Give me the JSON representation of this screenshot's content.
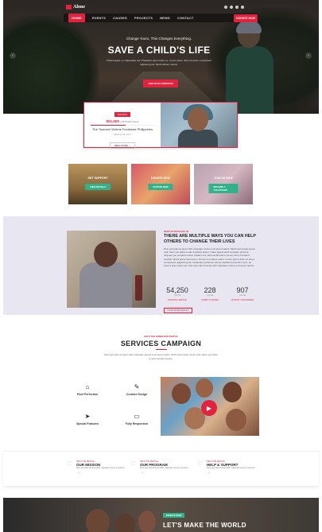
{
  "brand": {
    "name": "Alone",
    "accent": "#e3223e",
    "green": "#31b28a"
  },
  "nav": {
    "items": [
      "HOME",
      "EVENTS",
      "CAUSES",
      "PROJECTS",
      "NEWS",
      "CONTACT"
    ],
    "donate_label": "DONATE NOW"
  },
  "hero": {
    "subtitle": "Change Yours, This Changes Everything.",
    "title": "SAVE A CHILD'S LIFE",
    "description": "Pellentesque eu malesuada nisl. Phasellus eget ornare ex. Lorem ipsum dolor sit amet, consectetur adipiscing elit. Morbi dictum mauris.",
    "button": "JOIN OUR CAMPAIGN"
  },
  "campaign": {
    "tag": "DONATE",
    "raised": "$51,500",
    "goal": "of $75,000 raised",
    "progress": 0.55,
    "title": "The Tsunami Victims Fundraise Philippines",
    "date": "MARCH 18, 2017",
    "read_more": "READ MORE →"
  },
  "tiles": [
    {
      "title": "GET SUPPORT",
      "button": "VIEW DETAILS"
    },
    {
      "title": "DONATE NOW",
      "button": "DONATE NOW"
    },
    {
      "title": "JOIN US NOW",
      "button": "BECOME A VOLUNTEER"
    }
  ],
  "about": {
    "small": "WHAT IS OUR GOAL IN",
    "title": "THERE ARE MULTIPLE WAYS YOU CAN HELP OTHERS TO CHANGE THEIR LIVES",
    "text": "Duis sed odio sit amet nibh vulputate cursus a sit amet mauris. Morbi accumsan ipsum velit. Nam nec tellus a odio tincidunt auctor. Class aptent taciti sociosqu ad litora torquent per conubia nostra. Nullam nec velit condimentum sit am lorem tincidunt suscipit. Morbi accumsan ipsum. Donec vel mauris quam. Lorem ipsum dolor sit amet, consectetur adipiscing elit. Vestibulum pharetra. Donec facilisis fermentum sem, ac viverra ante luctus vel. Duis sed odio sit amet nibh vulputate cursus a sit amet mauris.",
    "stats": [
      {
        "num": "54,250",
        "lbl": "CAUSE",
        "link": "FINANCIAL PEOPLE"
      },
      {
        "num": "228",
        "lbl": "CAUSE",
        "link": "CHARITY CAUSES"
      },
      {
        "num": "907",
        "lbl": "CAUSE",
        "link": "CHARITY VOLUNTEERS"
      }
    ],
    "button": "KNOW MORE DETAILS"
  },
  "services": {
    "small": "HELP THE HOMELESS PEOPLE",
    "title": "SERVICES CAMPAIGN",
    "desc": "Duis sed odio sit amet nibh vulputate cursus a sit amet mauris. Morbi accumsan ipsum velit. Nam nec tellus a odio tincidunt auctor.",
    "items": [
      {
        "icon": "house-icon",
        "label": "Pixel Perfection"
      },
      {
        "icon": "pen-icon",
        "label": "Creative Design"
      },
      {
        "icon": "paper-plane-icon",
        "label": "Special Features"
      },
      {
        "icon": "monitor-icon",
        "label": "Fully Responsive"
      }
    ]
  },
  "missions": [
    {
      "small": "HELP THE PEOPLE",
      "title": "OUR MISSION",
      "desc": "Duis sed odio sit amet nibh vulputate cursus a sit amet"
    },
    {
      "small": "HELP THE PEOPLE",
      "title": "OUR PROGRAM",
      "desc": "Duis sed odio sit amet nibh vulputate cursus a sit amet"
    },
    {
      "small": "HELP THE PEOPLE",
      "title": "HELP & SUPPORT",
      "desc": "Duis sed odio sit amet nibh vulputate cursus a sit amet"
    }
  ],
  "banner": {
    "tag": "DONATE NOW",
    "title": "LET'S MAKE THE WORLD"
  }
}
